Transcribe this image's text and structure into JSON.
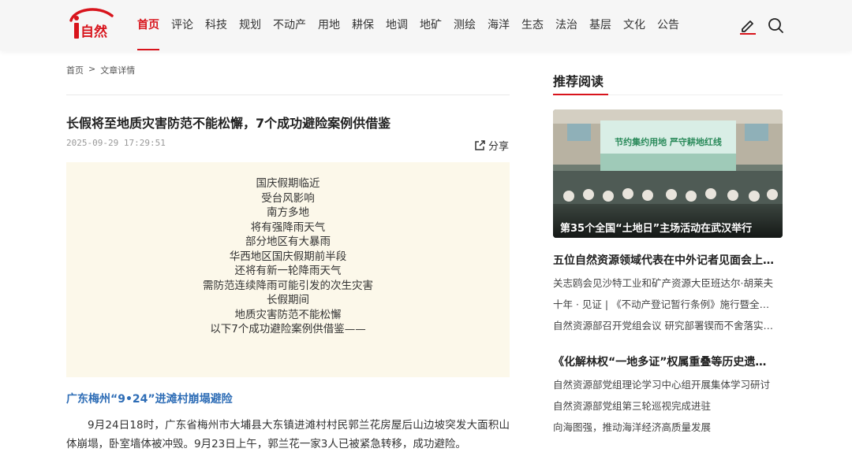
{
  "header": {
    "logo_text": "i自然",
    "nav": [
      "首页",
      "评论",
      "科技",
      "规划",
      "不动产",
      "用地",
      "耕保",
      "地调",
      "地矿",
      "测绘",
      "海洋",
      "生态",
      "法治",
      "基层",
      "文化",
      "公告"
    ],
    "active_index": 0,
    "icons": [
      "edit-icon",
      "search-icon"
    ]
  },
  "breadcrumb": {
    "home": "首页",
    "sep": ">",
    "current": "文章详情"
  },
  "article": {
    "title": "长假将至地质灾害防范不能松懈，7个成功避险案例供借鉴",
    "date": "2025-09-29 17:29:51",
    "share_label": "分享",
    "intro_lines": [
      "国庆假期临近",
      "受台风影响",
      "南方多地",
      "将有强降雨天气",
      "部分地区有大暴雨",
      "华西地区国庆假期前半段",
      "还将有新一轮降雨天气",
      "需防范连续降雨可能引发的次生灾害",
      "长假期间",
      "地质灾害防范不能松懈",
      "以下7个成功避险案例供借鉴——"
    ],
    "section_heading": "广东梅州“9•24”进滩村崩塌避险",
    "paragraph": "9月24日18时，广东省梅州市大埔县大东镇进滩村村民郭兰花房屋后山边坡突发大面积山体崩塌，卧室墙体被冲毁。9月23日上午，郭兰花一家3人已被紧急转移，成功避险。"
  },
  "sidebar": {
    "title": "推荐阅读",
    "feature": {
      "caption": "第35个全国“土地日”主场活动在武汉举行",
      "banner_text": "节约集约用地 严守耕地红线"
    },
    "groups": [
      {
        "headline": "五位自然资源领域代表在中外记者见面会上…",
        "links": [
          "关志鸥会见沙特工业和矿产资源大臣班达尔·胡莱夫",
          "十年 · 见证 | 《不动产登记暂行条例》施行暨全…",
          "自然资源部召开党组会议 研究部署锲而不舍落实…"
        ]
      },
      {
        "headline": "《化解林权“一地多证”权属重叠等历史遗…",
        "links": [
          "自然资源部党组理论学习中心组开展集体学习研讨",
          "自然资源部党组第三轮巡视完成进驻",
          "向海图强，推动海洋经济高质量发展"
        ]
      }
    ]
  },
  "colors": {
    "accent": "#d8141c",
    "link_blue": "#2e6db6",
    "intro_bg": "#fcf8ea"
  }
}
